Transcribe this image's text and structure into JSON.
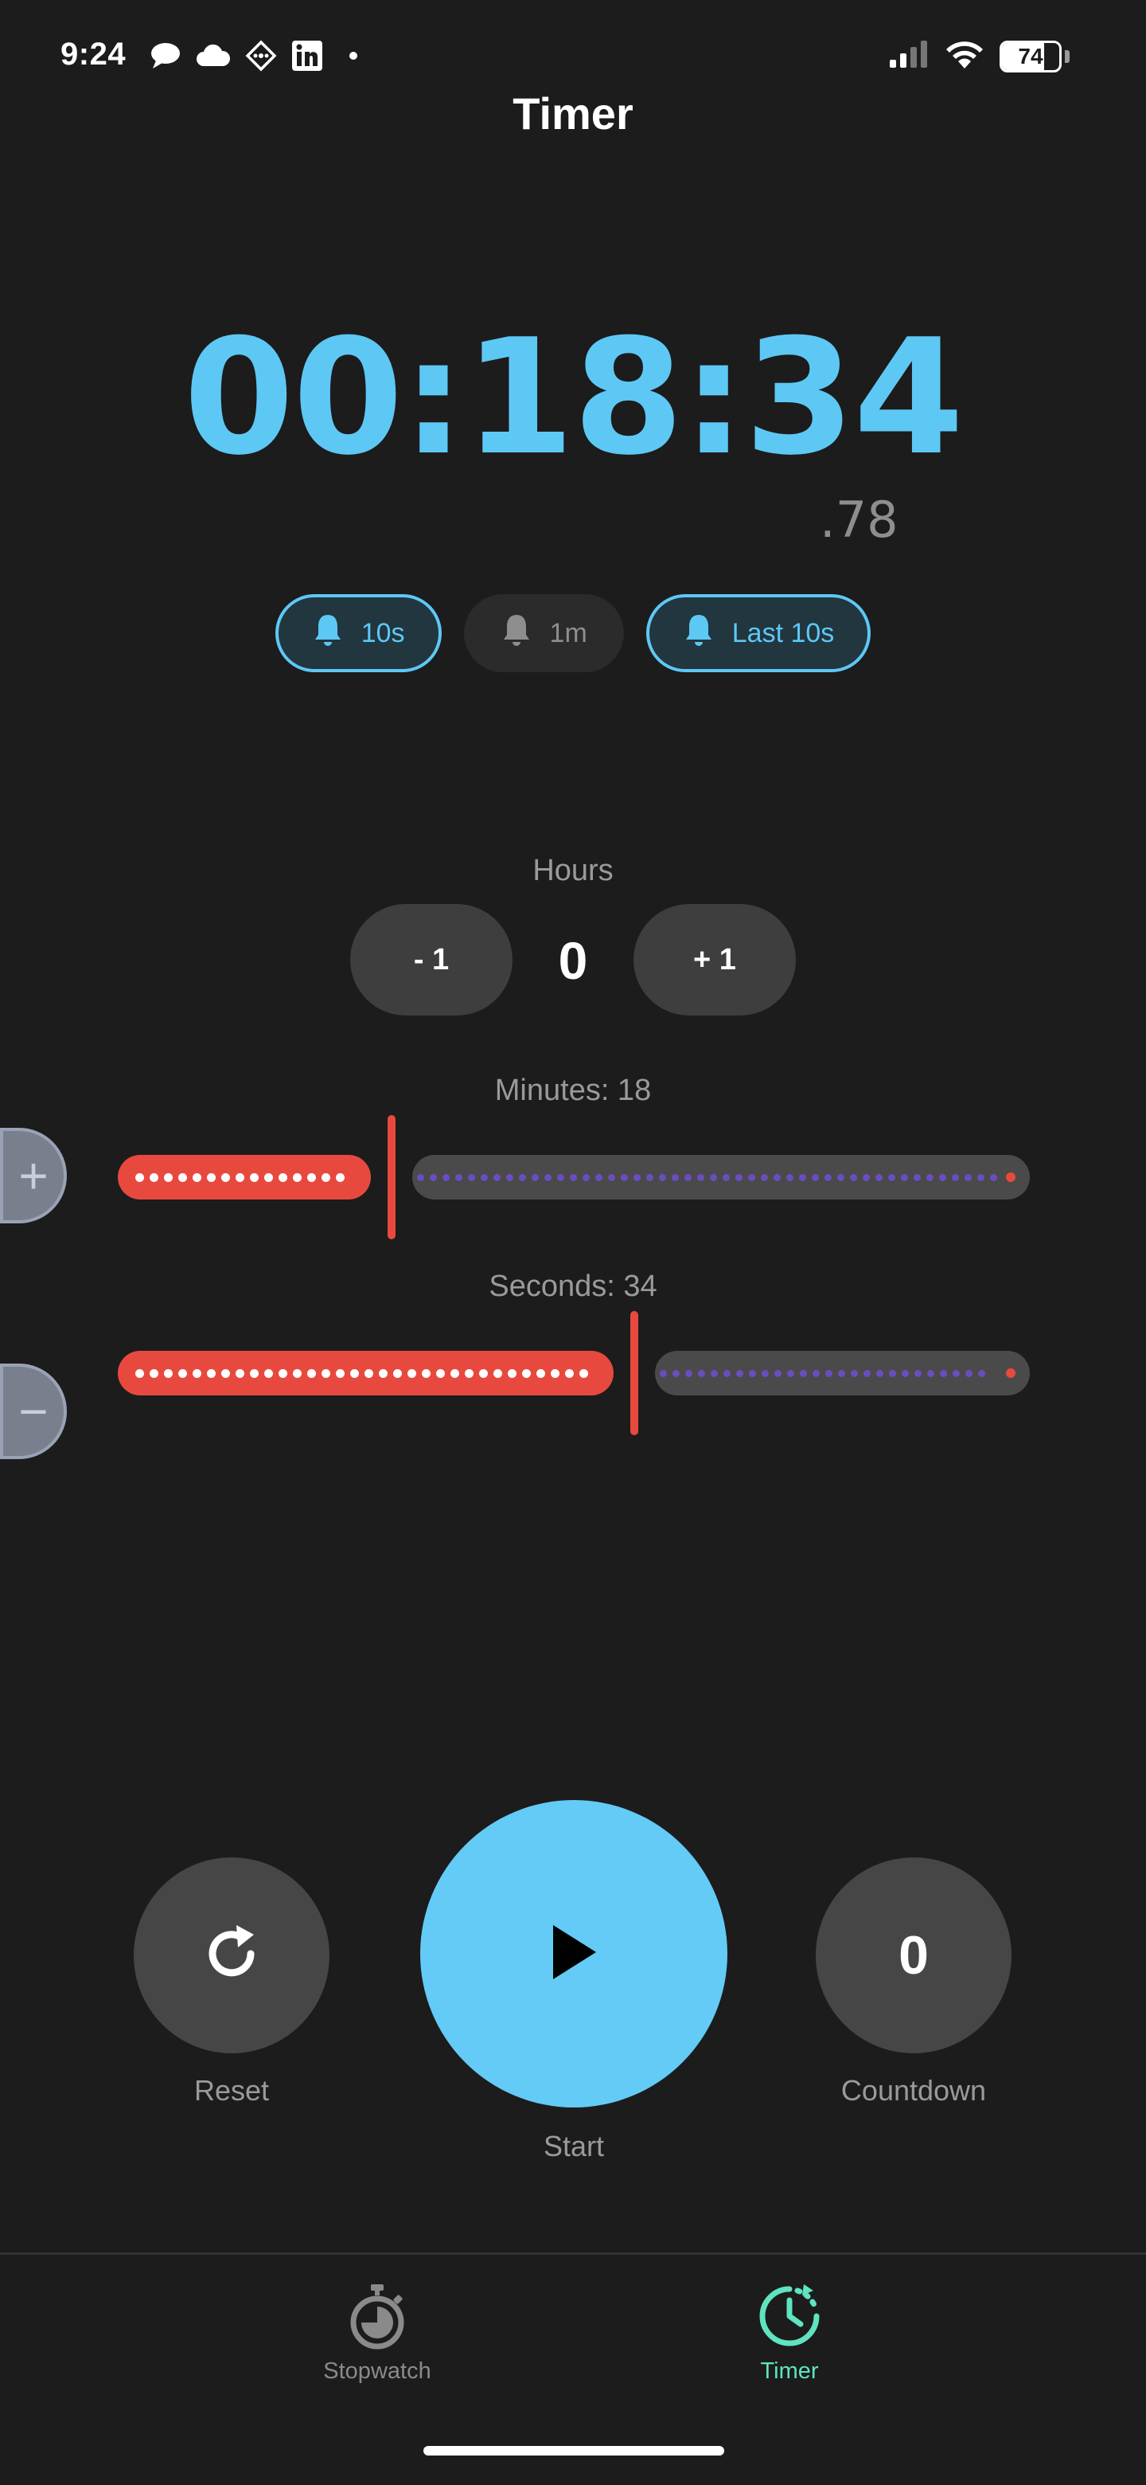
{
  "status_bar": {
    "time": "9:24",
    "battery": "74",
    "battery_level_percent": 74,
    "icons": [
      "message-icon",
      "cloud-icon",
      "app-icon",
      "linkedin-icon",
      "dot-icon",
      "signal-icon",
      "wifi-icon",
      "battery-icon"
    ]
  },
  "header": {
    "title": "Timer"
  },
  "display": {
    "time": "00:18:34",
    "centiseconds": ".78"
  },
  "alerts": [
    {
      "label": "10s",
      "active": true
    },
    {
      "label": "1m",
      "active": false
    },
    {
      "label": "Last 10s",
      "active": true
    }
  ],
  "hours": {
    "label": "Hours",
    "value": "0",
    "minus_label": "- 1",
    "plus_label": "+ 1"
  },
  "minutes": {
    "label": "Minutes: 18",
    "value": 18,
    "max": 60
  },
  "seconds": {
    "label": "Seconds: 34",
    "value": 34,
    "max": 60
  },
  "controls": {
    "reset_label": "Reset",
    "start_label": "Start",
    "countdown_label": "Countdown",
    "countdown_value": "0"
  },
  "tabs": [
    {
      "label": "Stopwatch",
      "active": false
    },
    {
      "label": "Timer",
      "active": true
    }
  ],
  "colors": {
    "accent_blue": "#5ec8f5",
    "accent_red": "#e8493e",
    "accent_green": "#5fe3c0",
    "background": "#1c1c1c"
  }
}
